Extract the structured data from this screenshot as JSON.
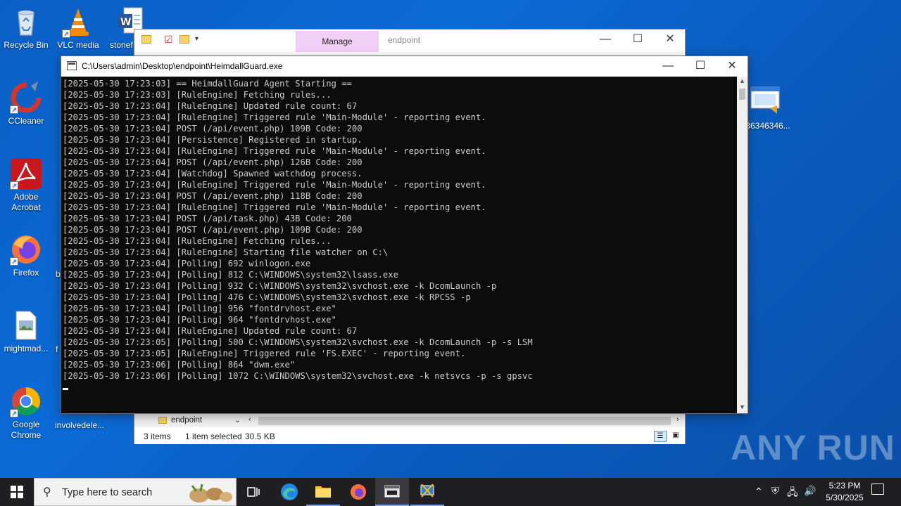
{
  "desktop": {
    "icons": [
      {
        "label": "Recycle Bin"
      },
      {
        "label": "VLC media"
      },
      {
        "label": "stonef"
      },
      {
        "label": "CCleaner"
      },
      {
        "label": "Adobe Acrobat"
      },
      {
        "label": "Firefox"
      },
      {
        "label": "b"
      },
      {
        "label": "mightmad..."
      },
      {
        "label": "f"
      },
      {
        "label": "Google Chrome"
      },
      {
        "label": "involvedele..."
      },
      {
        "label": "36346346..."
      }
    ]
  },
  "explorer": {
    "manage_tab": "Manage",
    "title": "endpoint",
    "nav_folder": "endpoint",
    "status": {
      "items": "3 items",
      "selected": "1 item selected",
      "size": "30.5 KB"
    }
  },
  "console": {
    "title": "C:\\Users\\admin\\Desktop\\endpoint\\HeimdallGuard.exe",
    "lines": [
      "[2025-05-30 17:23:03] == HeimdallGuard Agent Starting ==",
      "[2025-05-30 17:23:03] [RuleEngine] Fetching rules...",
      "[2025-05-30 17:23:04] [RuleEngine] Updated rule count: 67",
      "[2025-05-30 17:23:04] [RuleEngine] Triggered rule 'Main-Module' - reporting event.",
      "[2025-05-30 17:23:04] POST (/api/event.php) 109B Code: 200",
      "[2025-05-30 17:23:04] [Persistence] Registered in startup.",
      "[2025-05-30 17:23:04] [RuleEngine] Triggered rule 'Main-Module' - reporting event.",
      "[2025-05-30 17:23:04] POST (/api/event.php) 126B Code: 200",
      "[2025-05-30 17:23:04] [Watchdog] Spawned watchdog process.",
      "[2025-05-30 17:23:04] [RuleEngine] Triggered rule 'Main-Module' - reporting event.",
      "[2025-05-30 17:23:04] POST (/api/event.php) 118B Code: 200",
      "[2025-05-30 17:23:04] [RuleEngine] Triggered rule 'Main-Module' - reporting event.",
      "[2025-05-30 17:23:04] POST (/api/task.php) 43B Code: 200",
      "[2025-05-30 17:23:04] POST (/api/event.php) 109B Code: 200",
      "[2025-05-30 17:23:04] [RuleEngine] Fetching rules...",
      "[2025-05-30 17:23:04] [RuleEngine] Starting file watcher on C:\\",
      "[2025-05-30 17:23:04] [Polling] 692 winlogon.exe",
      "[2025-05-30 17:23:04] [Polling] 812 C:\\WINDOWS\\system32\\lsass.exe",
      "[2025-05-30 17:23:04] [Polling] 932 C:\\WINDOWS\\system32\\svchost.exe -k DcomLaunch -p",
      "[2025-05-30 17:23:04] [Polling] 476 C:\\WINDOWS\\system32\\svchost.exe -k RPCSS -p",
      "[2025-05-30 17:23:04] [Polling] 956 \"fontdrvhost.exe\"",
      "[2025-05-30 17:23:04] [Polling] 964 \"fontdrvhost.exe\"",
      "[2025-05-30 17:23:04] [RuleEngine] Updated rule count: 67",
      "[2025-05-30 17:23:05] [Polling] 500 C:\\WINDOWS\\system32\\svchost.exe -k DcomLaunch -p -s LSM",
      "[2025-05-30 17:23:05] [RuleEngine] Triggered rule 'FS.EXEC' - reporting event.",
      "[2025-05-30 17:23:06] [Polling] 864 \"dwm.exe\"",
      "[2025-05-30 17:23:06] [Polling] 1072 C:\\WINDOWS\\system32\\svchost.exe -k netsvcs -p -s gpsvc"
    ]
  },
  "taskbar": {
    "search_placeholder": "Type here to search",
    "time": "5:23 PM",
    "date": "5/30/2025"
  },
  "watermark": "ANY RUN",
  "colors": {
    "desktop": "#0b6ad6",
    "console_bg": "#0c0c0c",
    "console_text": "#cccccc",
    "manage_tab": "#f0d0f6",
    "taskbar": "#1f1f22"
  }
}
